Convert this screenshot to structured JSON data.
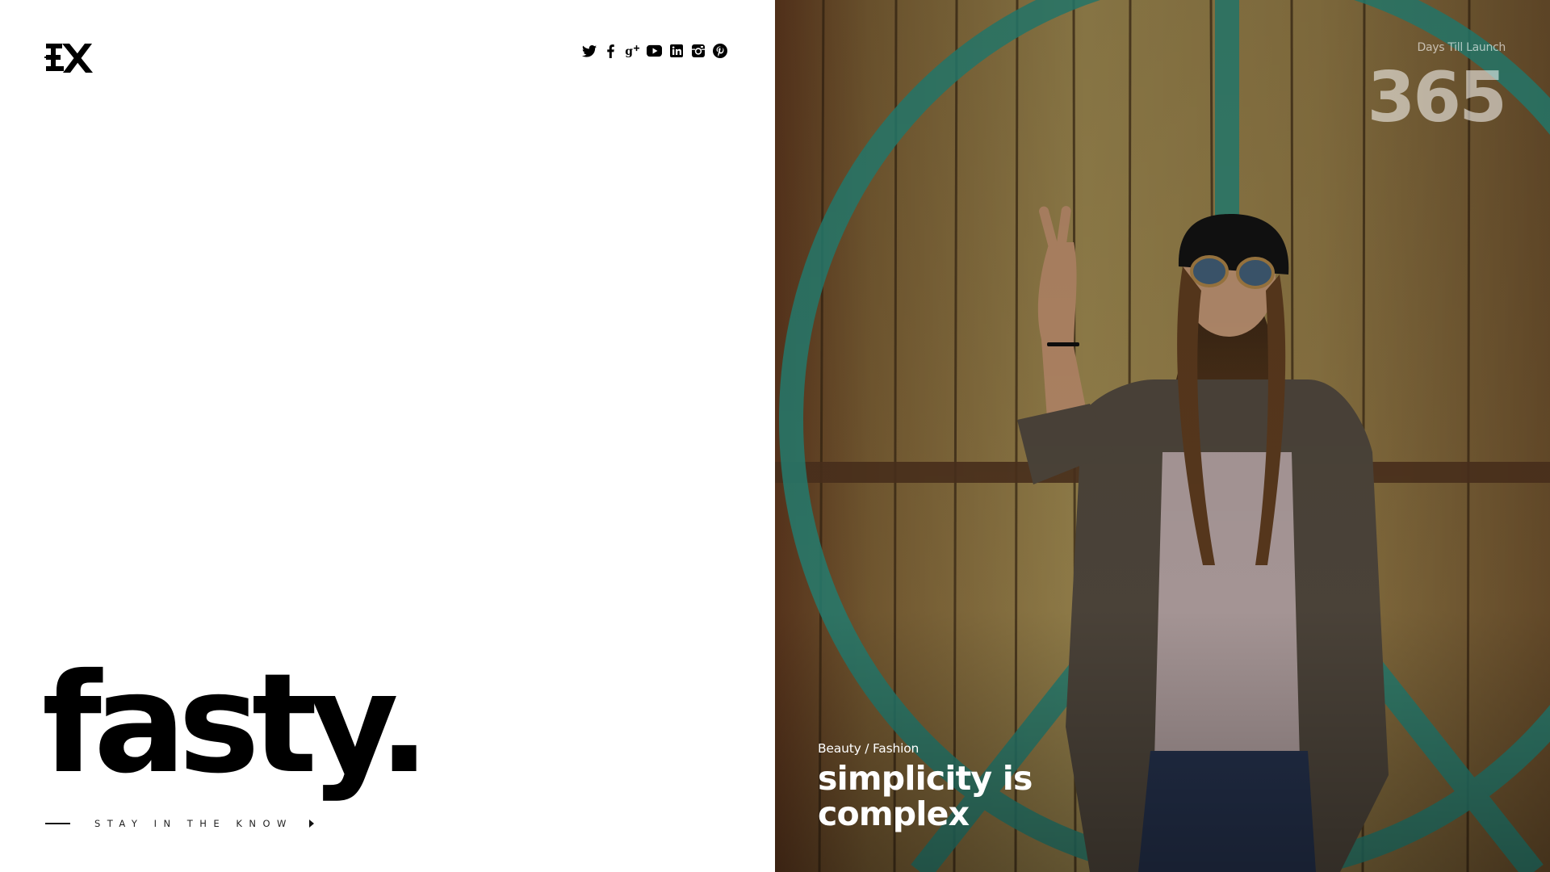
{
  "brand": {
    "logo_text": "EX",
    "wordmark": "fasty."
  },
  "social": [
    {
      "name": "twitter",
      "icon": "twitter-icon"
    },
    {
      "name": "facebook",
      "icon": "facebook-icon"
    },
    {
      "name": "google-plus",
      "icon": "google-plus-icon"
    },
    {
      "name": "youtube",
      "icon": "youtube-icon"
    },
    {
      "name": "linkedin",
      "icon": "linkedin-icon"
    },
    {
      "name": "instagram",
      "icon": "instagram-icon"
    },
    {
      "name": "pinterest",
      "icon": "pinterest-icon"
    }
  ],
  "cta": {
    "label": "STAY IN THE KNOW"
  },
  "countdown": {
    "label": "Days Till Launch",
    "value": "365"
  },
  "feature": {
    "category": "Beauty / Fashion",
    "title_line1": "simplicity is",
    "title_line2": "complex"
  },
  "colors": {
    "text": "#000000",
    "background": "#ffffff",
    "overlay_text": "#ffffff"
  }
}
